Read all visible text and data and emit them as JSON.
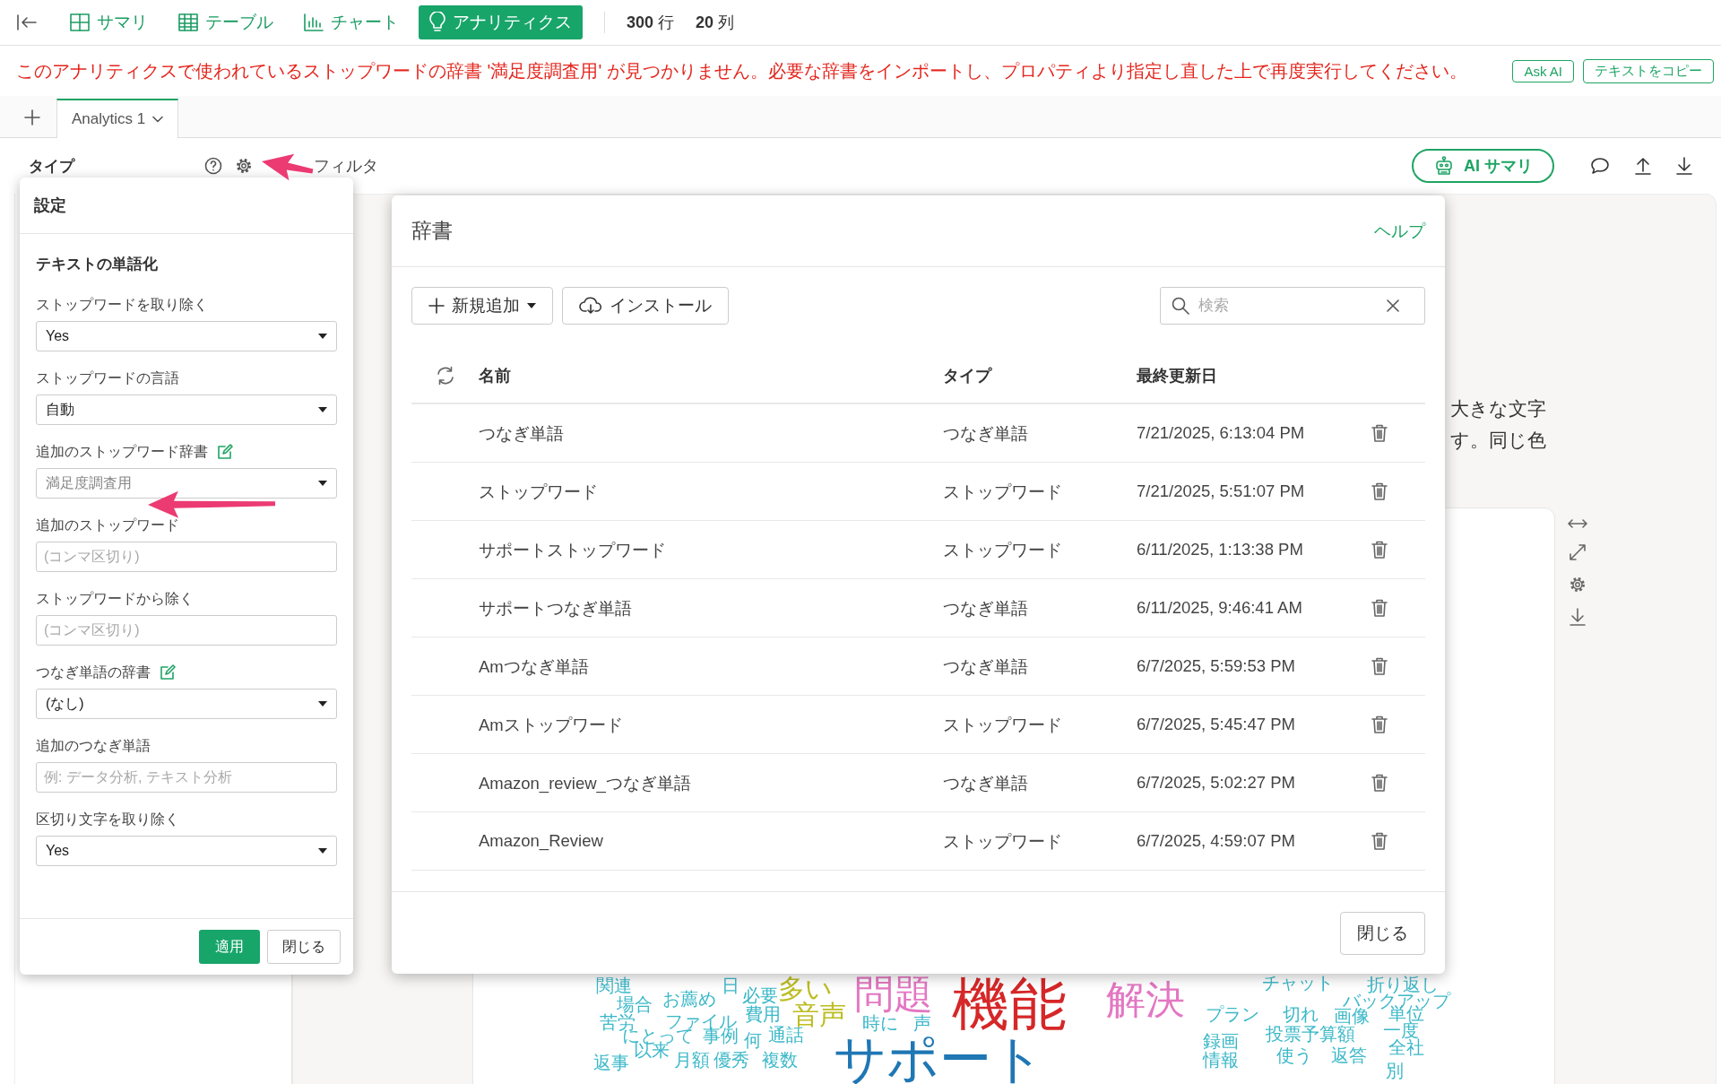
{
  "toolbar": {
    "tabs": [
      {
        "label": "サマリ",
        "selected": false
      },
      {
        "label": "テーブル",
        "selected": false
      },
      {
        "label": "チャート",
        "selected": false
      },
      {
        "label": "アナリティクス",
        "selected": true
      }
    ],
    "row_count": "**300** 行",
    "column_count": "**20** 列"
  },
  "error_bar": {
    "message": "このアナリティクスで使われているストップワードの辞書 '満足度調査用' が見つかりません。必要な辞書をインポートし、プロパティより指定し直した上で再度実行してください。",
    "buttons": [
      "Ask AI",
      "テキストをコピー"
    ]
  },
  "analytics_tabs": [
    {
      "label": "Analytics 1",
      "selected": true
    }
  ],
  "header": {
    "type_label": "タイプ",
    "filter_label": "フィルタ",
    "ai_button": "AI サマリ"
  },
  "background_text": [
    "大きな文字",
    "す。同じ色"
  ],
  "settings_panel": {
    "title": "設定",
    "section": "テキストの単語化",
    "fields": [
      {
        "label": "ストップワードを取り除く",
        "kind": "select",
        "value": "Yes",
        "missing": false
      },
      {
        "label": "ストップワードの言語",
        "kind": "select",
        "value": "自動",
        "missing": false
      },
      {
        "label": "追加のストップワード辞書",
        "kind": "select",
        "edit_icon": true,
        "value": "満足度調査用",
        "missing": true
      },
      {
        "label": "追加のストップワード",
        "kind": "text",
        "placeholder": "(コンマ区切り)"
      },
      {
        "label": "ストップワードから除く",
        "kind": "text",
        "placeholder": "(コンマ区切り)"
      },
      {
        "label": "つなぎ単語の辞書",
        "kind": "select",
        "edit_icon": true,
        "value": "(なし)",
        "missing": false
      },
      {
        "label": "追加のつなぎ単語",
        "kind": "text",
        "placeholder": "例: データ分析, テキスト分析"
      },
      {
        "label": "区切り文字を取り除く",
        "kind": "select",
        "value": "Yes",
        "missing": false
      }
    ],
    "apply_button": "適用",
    "close_button": "閉じる"
  },
  "dictionary_dialog": {
    "title": "辞書",
    "help_link": "ヘルプ",
    "add_button": "新規追加",
    "install_button": "インストール",
    "search": {
      "placeholder": "検索"
    },
    "columns": [
      "名前",
      "タイプ",
      "最終更新日"
    ],
    "rows": [
      {
        "name": "つなぎ単語",
        "type": "つなぎ単語",
        "updated": "7/21/2025, 6:13:04 PM"
      },
      {
        "name": "ストップワード",
        "type": "ストップワード",
        "updated": "7/21/2025, 5:51:07 PM"
      },
      {
        "name": "サポートストップワード",
        "type": "ストップワード",
        "updated": "6/11/2025, 1:13:38 PM"
      },
      {
        "name": "サポートつなぎ単語",
        "type": "つなぎ単語",
        "updated": "6/11/2025, 9:46:41 AM"
      },
      {
        "name": "Amつなぎ単語",
        "type": "つなぎ単語",
        "updated": "6/7/2025, 5:59:53 PM"
      },
      {
        "name": "Amストップワード",
        "type": "ストップワード",
        "updated": "6/7/2025, 5:45:47 PM"
      },
      {
        "name": "Amazon_review_つなぎ単語",
        "type": "つなぎ単語",
        "updated": "6/7/2025, 5:02:27 PM"
      },
      {
        "name": "Amazon_Review",
        "type": "ストップワード",
        "updated": "6/7/2025, 4:59:07 PM"
      }
    ],
    "close_button": "閉じる"
  },
  "word_cloud": {
    "words": [
      {
        "text": "関連",
        "color": "#3cb8c8",
        "kind": "small"
      },
      {
        "text": "場合",
        "color": "#3cb8c8",
        "kind": "small"
      },
      {
        "text": "お薦め",
        "color": "#3cb8c8",
        "kind": "small"
      },
      {
        "text": "日",
        "color": "#3cb8c8",
        "kind": "small"
      },
      {
        "text": "必要",
        "color": "#3cb8c8",
        "kind": "small"
      },
      {
        "text": "多い",
        "color": "#bcbd22",
        "kind": "medium"
      },
      {
        "text": "音声",
        "color": "#bcbd22",
        "kind": "medium"
      },
      {
        "text": "問題",
        "color": "#e377c2",
        "kind": "large"
      },
      {
        "text": "機能",
        "color": "#d62728",
        "kind": "xlarge"
      },
      {
        "text": "解決",
        "color": "#e377c2",
        "kind": "large"
      },
      {
        "text": "チャット",
        "color": "#3cb8c8",
        "kind": "small"
      },
      {
        "text": "折り返し",
        "color": "#3cb8c8",
        "kind": "small"
      },
      {
        "text": "バックアップ",
        "color": "#3cb8c8",
        "kind": "small"
      },
      {
        "text": "プラン",
        "color": "#3cb8c8",
        "kind": "small"
      },
      {
        "text": "切れ",
        "color": "#3cb8c8",
        "kind": "small"
      },
      {
        "text": "画像",
        "color": "#3cb8c8",
        "kind": "small"
      },
      {
        "text": "単位",
        "color": "#3cb8c8",
        "kind": "small"
      },
      {
        "text": "苦労",
        "color": "#3cb8c8",
        "kind": "small"
      },
      {
        "text": "ファイル",
        "color": "#3cb8c8",
        "kind": "small"
      },
      {
        "text": "費用",
        "color": "#3cb8c8",
        "kind": "small"
      },
      {
        "text": "時に",
        "color": "#3cb8c8",
        "kind": "small"
      },
      {
        "text": "声",
        "color": "#3cb8c8",
        "kind": "small"
      },
      {
        "text": "にとって",
        "color": "#3cb8c8",
        "kind": "small"
      },
      {
        "text": "事例",
        "color": "#3cb8c8",
        "kind": "small"
      },
      {
        "text": "何",
        "color": "#3cb8c8",
        "kind": "small"
      },
      {
        "text": "通話",
        "color": "#3cb8c8",
        "kind": "small"
      },
      {
        "text": "サポート",
        "color": "#1f77b4",
        "kind": "huge"
      },
      {
        "text": "録画",
        "color": "#3cb8c8",
        "kind": "small"
      },
      {
        "text": "投票",
        "color": "#3cb8c8",
        "kind": "small"
      },
      {
        "text": "予算額",
        "color": "#3cb8c8",
        "kind": "small"
      },
      {
        "text": "一度",
        "color": "#3cb8c8",
        "kind": "small"
      },
      {
        "text": "全社",
        "color": "#3cb8c8",
        "kind": "small"
      },
      {
        "text": "返事",
        "color": "#3cb8c8",
        "kind": "small"
      },
      {
        "text": "以来",
        "color": "#3cb8c8",
        "kind": "small"
      },
      {
        "text": "月額",
        "color": "#3cb8c8",
        "kind": "small"
      },
      {
        "text": "優秀",
        "color": "#3cb8c8",
        "kind": "small"
      },
      {
        "text": "複数",
        "color": "#3cb8c8",
        "kind": "small"
      },
      {
        "text": "情報",
        "color": "#3cb8c8",
        "kind": "small"
      },
      {
        "text": "使う",
        "color": "#3cb8c8",
        "kind": "small"
      },
      {
        "text": "返答",
        "color": "#3cb8c8",
        "kind": "small"
      },
      {
        "text": "別",
        "color": "#3cb8c8",
        "kind": "small"
      }
    ]
  }
}
